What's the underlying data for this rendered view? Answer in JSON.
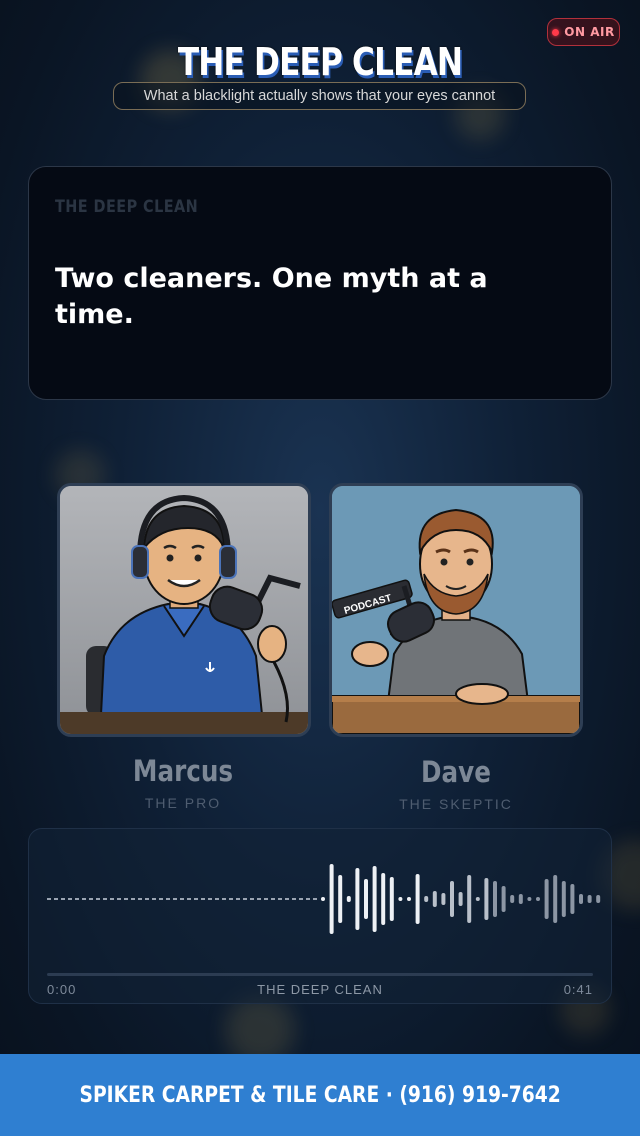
{
  "header": {
    "title": "THE DEEP CLEAN",
    "subtitle": "What a blacklight actually shows that your eyes cannot",
    "live_badge": "ON AIR"
  },
  "card": {
    "kicker": "THE DEEP CLEAN",
    "headline": "Two cleaners. One myth at a time."
  },
  "hosts": [
    {
      "name": "Marcus",
      "role": "THE PRO"
    },
    {
      "name": "Dave",
      "role": "THE SKEPTIC",
      "mic_label": "PODCAST"
    }
  ],
  "player": {
    "current_time": "0:00",
    "track_name": "THE DEEP CLEAN",
    "duration": "0:41",
    "progress": 0
  },
  "footer": {
    "text": "SPIKER CARPET & TILE CARE · (916) 919-7642"
  },
  "colors": {
    "accent": "#2f7fd1",
    "live": "#ff3a4a",
    "background": "#0f2036"
  }
}
